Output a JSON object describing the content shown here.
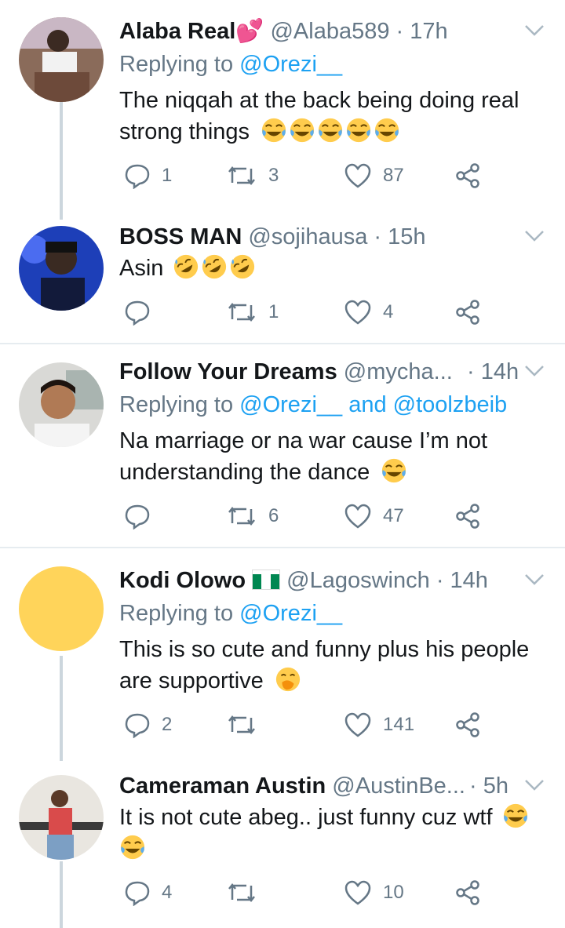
{
  "tweets": [
    {
      "name": "Alaba Real",
      "name_emoji": "💕",
      "handle": "@Alaba589",
      "time": "· 17h",
      "replying_prefix": "Replying to",
      "replying_to": "@Orezi__",
      "text_line1": "The niqqah at the back being doing real",
      "text_line2": "strong things",
      "replies": "1",
      "retweets": "3",
      "likes": "87"
    },
    {
      "name": "BOSS MAN",
      "handle": "@sojihausa",
      "time": "· 15h",
      "text_line1": "Asin",
      "replies": "",
      "retweets": "1",
      "likes": "4"
    },
    {
      "name": "Follow Your Dreams",
      "handle": "@mycha...",
      "time": "· 14h",
      "replying_prefix": "Replying to",
      "replying_to": "@Orezi__",
      "replying_and": "and",
      "replying_to2": "@toolzbeib",
      "text_line1": "Na marriage or na war cause I’m not",
      "text_line2": "understanding the dance",
      "replies": "",
      "retweets": "6",
      "likes": "47"
    },
    {
      "name": "Kodi Olowo",
      "handle": "@Lagoswinch",
      "time": "· 14h",
      "replying_prefix": "Replying to",
      "replying_to": "@Orezi__",
      "text_line1": "This is so cute and funny plus his people",
      "text_line2": "are supportive",
      "replies": "2",
      "retweets": "",
      "likes": "141"
    },
    {
      "name": "Cameraman Austin",
      "handle": "@AustinBe...",
      "time": "· 5h",
      "text_line1": "It is not cute abeg.. just funny cuz wtf",
      "replies": "4",
      "retweets": "",
      "likes": "10"
    }
  ],
  "colors": {
    "accent": "#1da1f2",
    "muted": "#657786",
    "line": "#ccd6dd"
  },
  "icons": [
    "reply-icon",
    "retweet-icon",
    "like-icon",
    "share-icon",
    "caret-down-icon",
    "joy-emoji",
    "rofl-emoji",
    "face-with-hand-emoji",
    "nigeria-flag"
  ]
}
